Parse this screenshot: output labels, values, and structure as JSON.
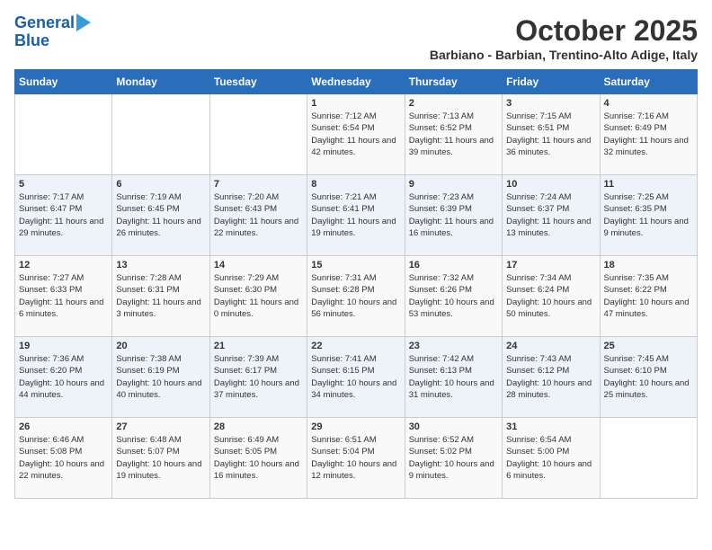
{
  "header": {
    "logo_line1": "General",
    "logo_line2": "Blue",
    "month": "October 2025",
    "subtitle": "Barbiano - Barbian, Trentino-Alto Adige, Italy"
  },
  "days_of_week": [
    "Sunday",
    "Monday",
    "Tuesday",
    "Wednesday",
    "Thursday",
    "Friday",
    "Saturday"
  ],
  "weeks": [
    [
      {
        "day": "",
        "content": ""
      },
      {
        "day": "",
        "content": ""
      },
      {
        "day": "",
        "content": ""
      },
      {
        "day": "1",
        "content": "Sunrise: 7:12 AM\nSunset: 6:54 PM\nDaylight: 11 hours and 42 minutes."
      },
      {
        "day": "2",
        "content": "Sunrise: 7:13 AM\nSunset: 6:52 PM\nDaylight: 11 hours and 39 minutes."
      },
      {
        "day": "3",
        "content": "Sunrise: 7:15 AM\nSunset: 6:51 PM\nDaylight: 11 hours and 36 minutes."
      },
      {
        "day": "4",
        "content": "Sunrise: 7:16 AM\nSunset: 6:49 PM\nDaylight: 11 hours and 32 minutes."
      }
    ],
    [
      {
        "day": "5",
        "content": "Sunrise: 7:17 AM\nSunset: 6:47 PM\nDaylight: 11 hours and 29 minutes."
      },
      {
        "day": "6",
        "content": "Sunrise: 7:19 AM\nSunset: 6:45 PM\nDaylight: 11 hours and 26 minutes."
      },
      {
        "day": "7",
        "content": "Sunrise: 7:20 AM\nSunset: 6:43 PM\nDaylight: 11 hours and 22 minutes."
      },
      {
        "day": "8",
        "content": "Sunrise: 7:21 AM\nSunset: 6:41 PM\nDaylight: 11 hours and 19 minutes."
      },
      {
        "day": "9",
        "content": "Sunrise: 7:23 AM\nSunset: 6:39 PM\nDaylight: 11 hours and 16 minutes."
      },
      {
        "day": "10",
        "content": "Sunrise: 7:24 AM\nSunset: 6:37 PM\nDaylight: 11 hours and 13 minutes."
      },
      {
        "day": "11",
        "content": "Sunrise: 7:25 AM\nSunset: 6:35 PM\nDaylight: 11 hours and 9 minutes."
      }
    ],
    [
      {
        "day": "12",
        "content": "Sunrise: 7:27 AM\nSunset: 6:33 PM\nDaylight: 11 hours and 6 minutes."
      },
      {
        "day": "13",
        "content": "Sunrise: 7:28 AM\nSunset: 6:31 PM\nDaylight: 11 hours and 3 minutes."
      },
      {
        "day": "14",
        "content": "Sunrise: 7:29 AM\nSunset: 6:30 PM\nDaylight: 11 hours and 0 minutes."
      },
      {
        "day": "15",
        "content": "Sunrise: 7:31 AM\nSunset: 6:28 PM\nDaylight: 10 hours and 56 minutes."
      },
      {
        "day": "16",
        "content": "Sunrise: 7:32 AM\nSunset: 6:26 PM\nDaylight: 10 hours and 53 minutes."
      },
      {
        "day": "17",
        "content": "Sunrise: 7:34 AM\nSunset: 6:24 PM\nDaylight: 10 hours and 50 minutes."
      },
      {
        "day": "18",
        "content": "Sunrise: 7:35 AM\nSunset: 6:22 PM\nDaylight: 10 hours and 47 minutes."
      }
    ],
    [
      {
        "day": "19",
        "content": "Sunrise: 7:36 AM\nSunset: 6:20 PM\nDaylight: 10 hours and 44 minutes."
      },
      {
        "day": "20",
        "content": "Sunrise: 7:38 AM\nSunset: 6:19 PM\nDaylight: 10 hours and 40 minutes."
      },
      {
        "day": "21",
        "content": "Sunrise: 7:39 AM\nSunset: 6:17 PM\nDaylight: 10 hours and 37 minutes."
      },
      {
        "day": "22",
        "content": "Sunrise: 7:41 AM\nSunset: 6:15 PM\nDaylight: 10 hours and 34 minutes."
      },
      {
        "day": "23",
        "content": "Sunrise: 7:42 AM\nSunset: 6:13 PM\nDaylight: 10 hours and 31 minutes."
      },
      {
        "day": "24",
        "content": "Sunrise: 7:43 AM\nSunset: 6:12 PM\nDaylight: 10 hours and 28 minutes."
      },
      {
        "day": "25",
        "content": "Sunrise: 7:45 AM\nSunset: 6:10 PM\nDaylight: 10 hours and 25 minutes."
      }
    ],
    [
      {
        "day": "26",
        "content": "Sunrise: 6:46 AM\nSunset: 5:08 PM\nDaylight: 10 hours and 22 minutes."
      },
      {
        "day": "27",
        "content": "Sunrise: 6:48 AM\nSunset: 5:07 PM\nDaylight: 10 hours and 19 minutes."
      },
      {
        "day": "28",
        "content": "Sunrise: 6:49 AM\nSunset: 5:05 PM\nDaylight: 10 hours and 16 minutes."
      },
      {
        "day": "29",
        "content": "Sunrise: 6:51 AM\nSunset: 5:04 PM\nDaylight: 10 hours and 12 minutes."
      },
      {
        "day": "30",
        "content": "Sunrise: 6:52 AM\nSunset: 5:02 PM\nDaylight: 10 hours and 9 minutes."
      },
      {
        "day": "31",
        "content": "Sunrise: 6:54 AM\nSunset: 5:00 PM\nDaylight: 10 hours and 6 minutes."
      },
      {
        "day": "",
        "content": ""
      }
    ]
  ]
}
